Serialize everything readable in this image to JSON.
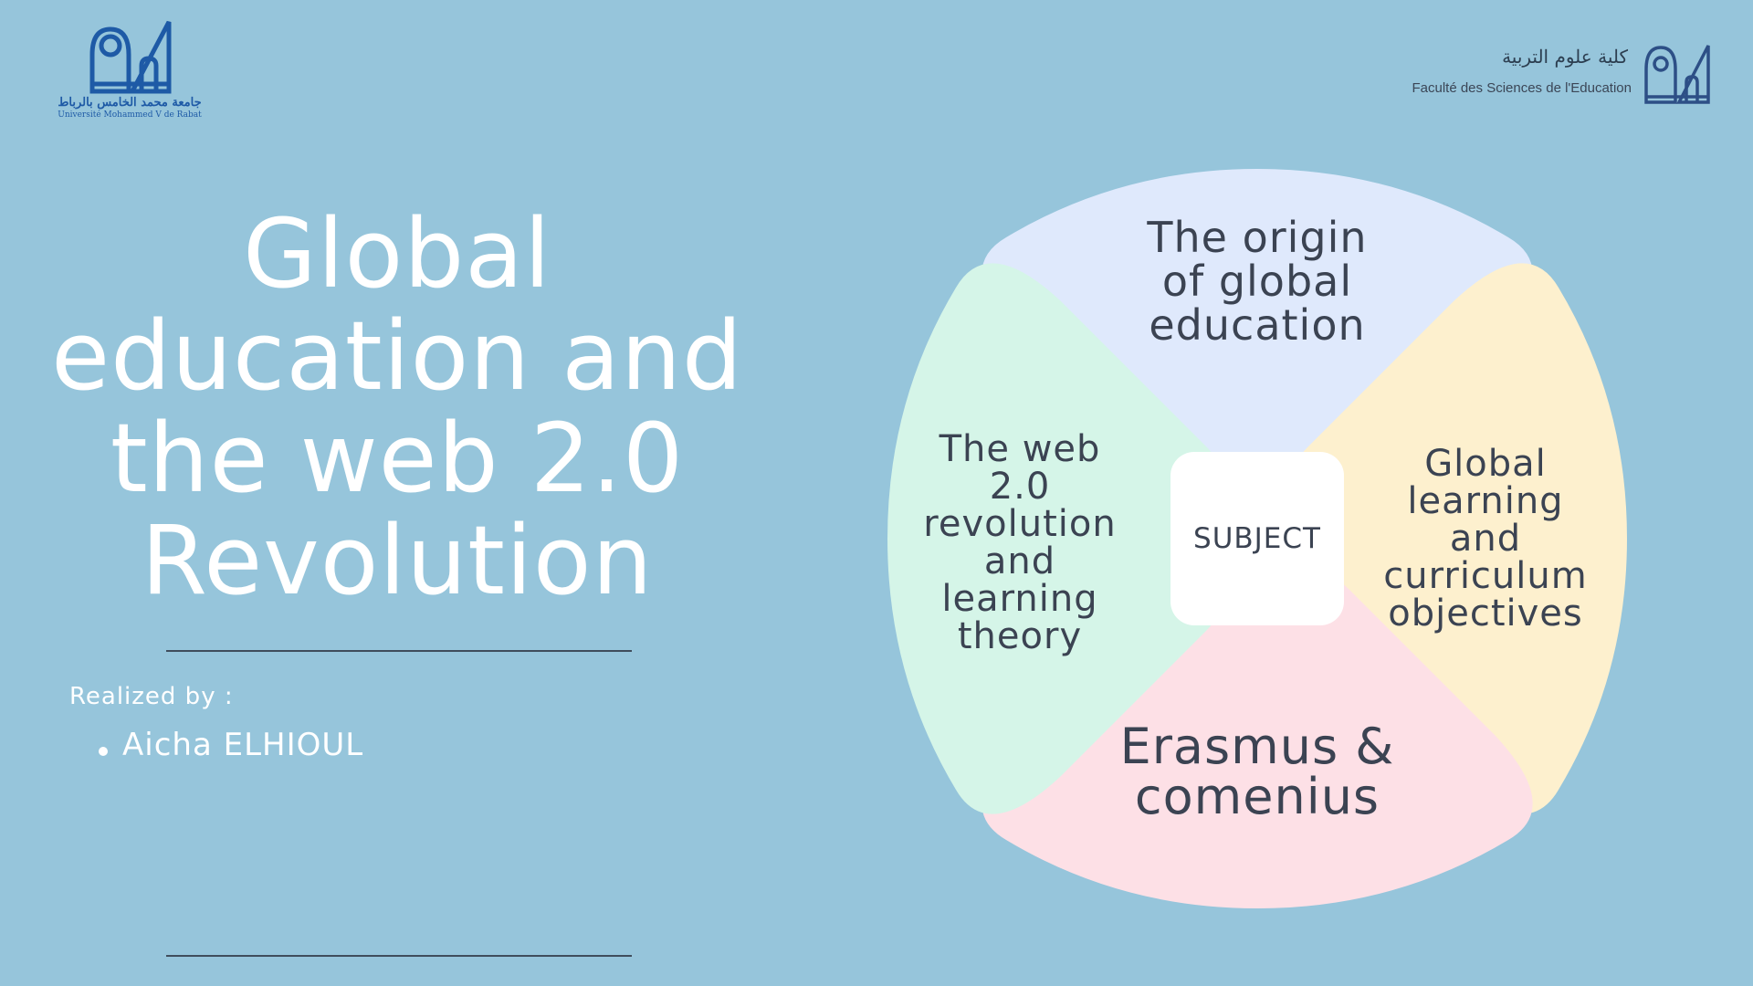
{
  "logos": {
    "left_arabic": "جامعة محمد الخامس بالرباط",
    "left_french": "Université Mohammed V de Rabat",
    "right_arabic": "كلية علوم التربية",
    "right_french": "Faculté des Sciences de l'Education"
  },
  "title_lines": [
    "Global",
    "education and",
    "the web 2.0",
    "Revolution"
  ],
  "realized_label": "Realized by :",
  "authors": [
    "Aicha ELHIOUL"
  ],
  "diagram": {
    "center": "SUBJECT",
    "top": [
      "The origin",
      "of global",
      "education"
    ],
    "right": [
      "Global",
      "learning",
      "and",
      "curriculum",
      "objectives"
    ],
    "bottom": [
      "Erasmus &",
      "comenius"
    ],
    "left": [
      "The web",
      "2.0",
      "revolution",
      "and",
      "learning",
      "theory"
    ],
    "colors": {
      "top": "#dfe9fc",
      "right": "#fdf0ce",
      "bottom": "#fde0e6",
      "left": "#d5f5e8",
      "background": "#96c5db"
    }
  }
}
